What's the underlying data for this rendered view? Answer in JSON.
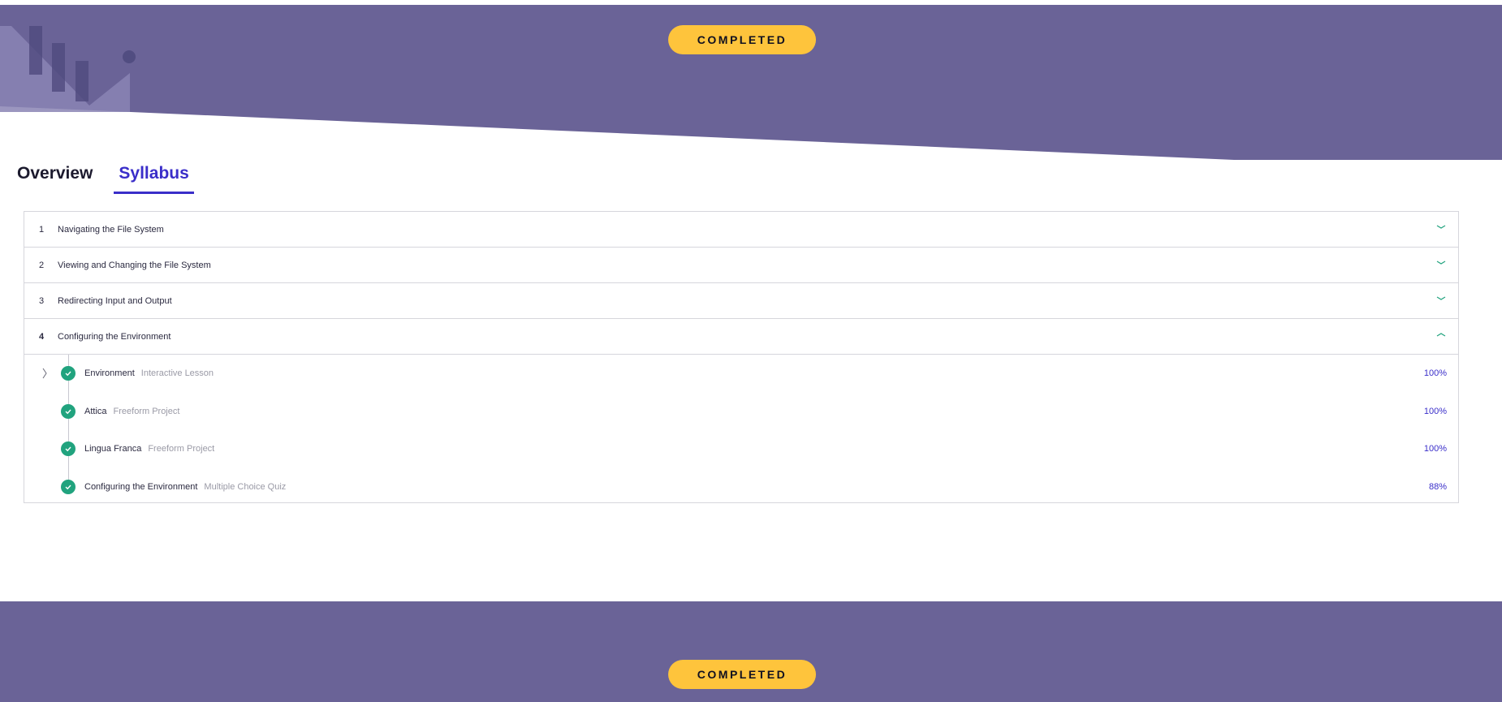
{
  "hero": {
    "badge": "COMPLETED"
  },
  "tabs": [
    {
      "label": "Overview",
      "active": false
    },
    {
      "label": "Syllabus",
      "active": true
    }
  ],
  "modules": [
    {
      "number": "1",
      "title": "Navigating the File System",
      "expanded": false
    },
    {
      "number": "2",
      "title": "Viewing and Changing the File System",
      "expanded": false
    },
    {
      "number": "3",
      "title": "Redirecting Input and Output",
      "expanded": false
    },
    {
      "number": "4",
      "title": "Configuring the Environment",
      "expanded": true,
      "lessons": [
        {
          "title": "Environment",
          "type": "Interactive Lesson",
          "progress": "100%",
          "status": "completed"
        },
        {
          "title": "Attica",
          "type": "Freeform Project",
          "progress": "100%",
          "status": "completed"
        },
        {
          "title": "Lingua Franca",
          "type": "Freeform Project",
          "progress": "100%",
          "status": "completed"
        },
        {
          "title": "Configuring the Environment",
          "type": "Multiple Choice Quiz",
          "progress": "88%",
          "status": "completed"
        }
      ]
    }
  ],
  "footer": {
    "badge": "COMPLETED"
  },
  "colors": {
    "banner": "#6a6397",
    "badge": "#fec43c",
    "accent": "#3a2ec9",
    "check": "#21a37e"
  },
  "icons": {
    "chevron_collapsed": "chevron-down-icon",
    "chevron_expanded": "chevron-up-icon",
    "lesson_status": "check-circle-icon",
    "lesson_expand": "chevron-right-icon"
  }
}
